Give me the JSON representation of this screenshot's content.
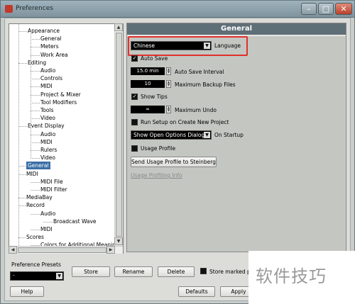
{
  "window": {
    "title": "Preferences"
  },
  "tree": {
    "items": [
      {
        "label": "Appearance",
        "level": 1
      },
      {
        "label": "General",
        "level": 2
      },
      {
        "label": "Meters",
        "level": 2
      },
      {
        "label": "Work Area",
        "level": 2
      },
      {
        "label": "Editing",
        "level": 1
      },
      {
        "label": "Audio",
        "level": 2
      },
      {
        "label": "Controls",
        "level": 2
      },
      {
        "label": "MIDI",
        "level": 2
      },
      {
        "label": "Project & Mixer",
        "level": 2
      },
      {
        "label": "Tool Modifiers",
        "level": 2
      },
      {
        "label": "Tools",
        "level": 2
      },
      {
        "label": "Video",
        "level": 2
      },
      {
        "label": "Event Display",
        "level": 1
      },
      {
        "label": "Audio",
        "level": 2
      },
      {
        "label": "MIDI",
        "level": 2
      },
      {
        "label": "Rulers",
        "level": 2
      },
      {
        "label": "Video",
        "level": 2
      },
      {
        "label": "General",
        "level": 0
      },
      {
        "label": "MIDI",
        "level": 0
      },
      {
        "label": "MIDI File",
        "level": 2
      },
      {
        "label": "MIDI Filter",
        "level": 2
      },
      {
        "label": "MediaBay",
        "level": 0
      },
      {
        "label": "Record",
        "level": 0
      },
      {
        "label": "Audio",
        "level": 2
      },
      {
        "label": "Broadcast Wave",
        "level": 3
      },
      {
        "label": "MIDI",
        "level": 2
      },
      {
        "label": "Scores",
        "level": 0
      },
      {
        "label": "Colors for Additional Meanings",
        "level": 2
      }
    ],
    "selected": "General"
  },
  "general": {
    "header": "General",
    "language": {
      "value": "Chinese",
      "label": "Language"
    },
    "auto_save": {
      "label": "Auto Save",
      "checked": true
    },
    "auto_save_interval": {
      "value": "15.0 min",
      "label": "Auto Save Interval"
    },
    "max_backup_files": {
      "value": "10",
      "label": "Maximum Backup Files"
    },
    "show_tips": {
      "label": "Show Tips",
      "checked": true
    },
    "max_undo": {
      "value": "∞",
      "label": "Maximum Undo"
    },
    "run_setup": {
      "label": "Run Setup on Create New Project",
      "checked": false
    },
    "on_startup": {
      "value": "Show Open Options Dialog",
      "label": "On Startup"
    },
    "usage_profile": {
      "label": "Usage Profile",
      "checked": false
    },
    "send_usage_button": "Send Usage Profile to Steinberg",
    "usage_info_link": "Usage Profiling Info"
  },
  "presets": {
    "label": "Preference Presets",
    "value": "-",
    "store": "Store",
    "rename": "Rename",
    "delete": "Delete",
    "store_marked": "Store marked pre"
  },
  "footer": {
    "help": "Help",
    "defaults": "Defaults",
    "apply": "Apply"
  },
  "watermark": "软件技巧",
  "colors": {
    "header_bg": "#5f6f77",
    "selection": "#3a6ea5",
    "highlight_border": "#e0302a"
  }
}
